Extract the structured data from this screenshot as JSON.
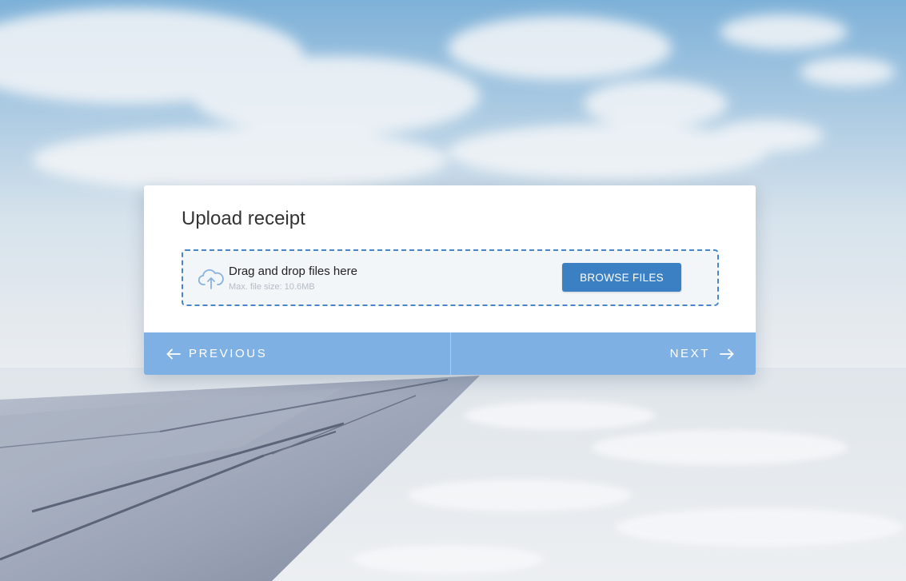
{
  "dialog": {
    "title": "Upload receipt"
  },
  "dropzone": {
    "instruction": "Drag and drop files here",
    "limit": "Max. file size: 10.6MB",
    "icon": "cloud-upload-icon",
    "browse_label": "BROWSE FILES"
  },
  "footer": {
    "previous_label": "PREVIOUS",
    "next_label": "NEXT",
    "previous_icon": "arrow-left-icon",
    "next_icon": "arrow-right-icon"
  },
  "colors": {
    "accent": "#3c80c4",
    "footer": "#7fb0e4",
    "dropzone_border": "#4a86c5",
    "dropzone_bg": "#f3f6f9"
  }
}
